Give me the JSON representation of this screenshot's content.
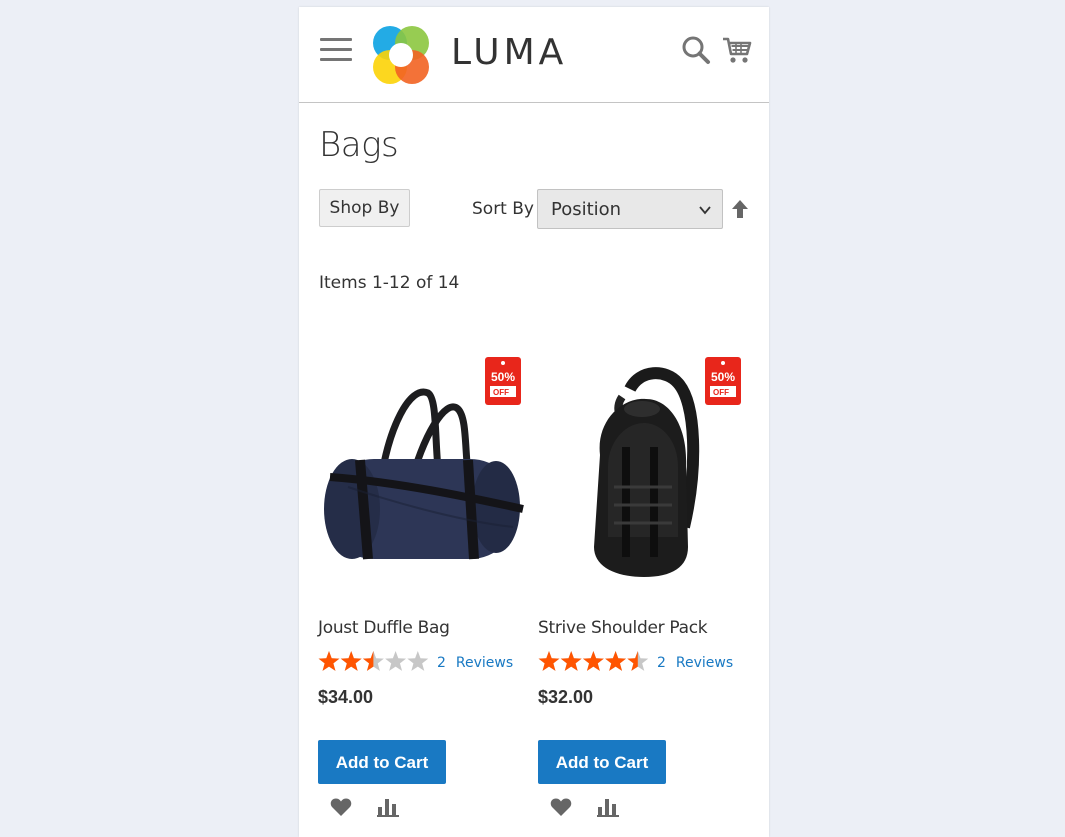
{
  "header": {
    "brand": "LUMA",
    "icons": [
      "menu-icon",
      "luma-logo",
      "search-icon",
      "cart-icon"
    ]
  },
  "page": {
    "title": "Bags"
  },
  "toolbar": {
    "shop_by_label": "Shop By",
    "sort_label": "Sort By",
    "sort_value": "Position",
    "items_text": "Items 1-12 of 14"
  },
  "products": [
    {
      "name": "Joust Duffle Bag",
      "rating_stars": 2.5,
      "rating_max": 5,
      "review_count": "2",
      "review_label": "Reviews",
      "price": "$34.00",
      "add_to_cart": "Add to Cart",
      "badge": {
        "top": "50%",
        "bottom": "OFF"
      }
    },
    {
      "name": "Strive Shoulder Pack",
      "rating_stars": 4.5,
      "rating_max": 5,
      "review_count": "2",
      "review_label": "Reviews",
      "price": "$32.00",
      "add_to_cart": "Add to Cart",
      "badge": {
        "top": "50%",
        "bottom": "OFF"
      }
    }
  ],
  "colors": {
    "accent": "#1979c3",
    "star_filled": "#ff5501",
    "star_empty": "#c7c7c7",
    "badge_red": "#e8261b",
    "page_bg": "#eceff6"
  }
}
